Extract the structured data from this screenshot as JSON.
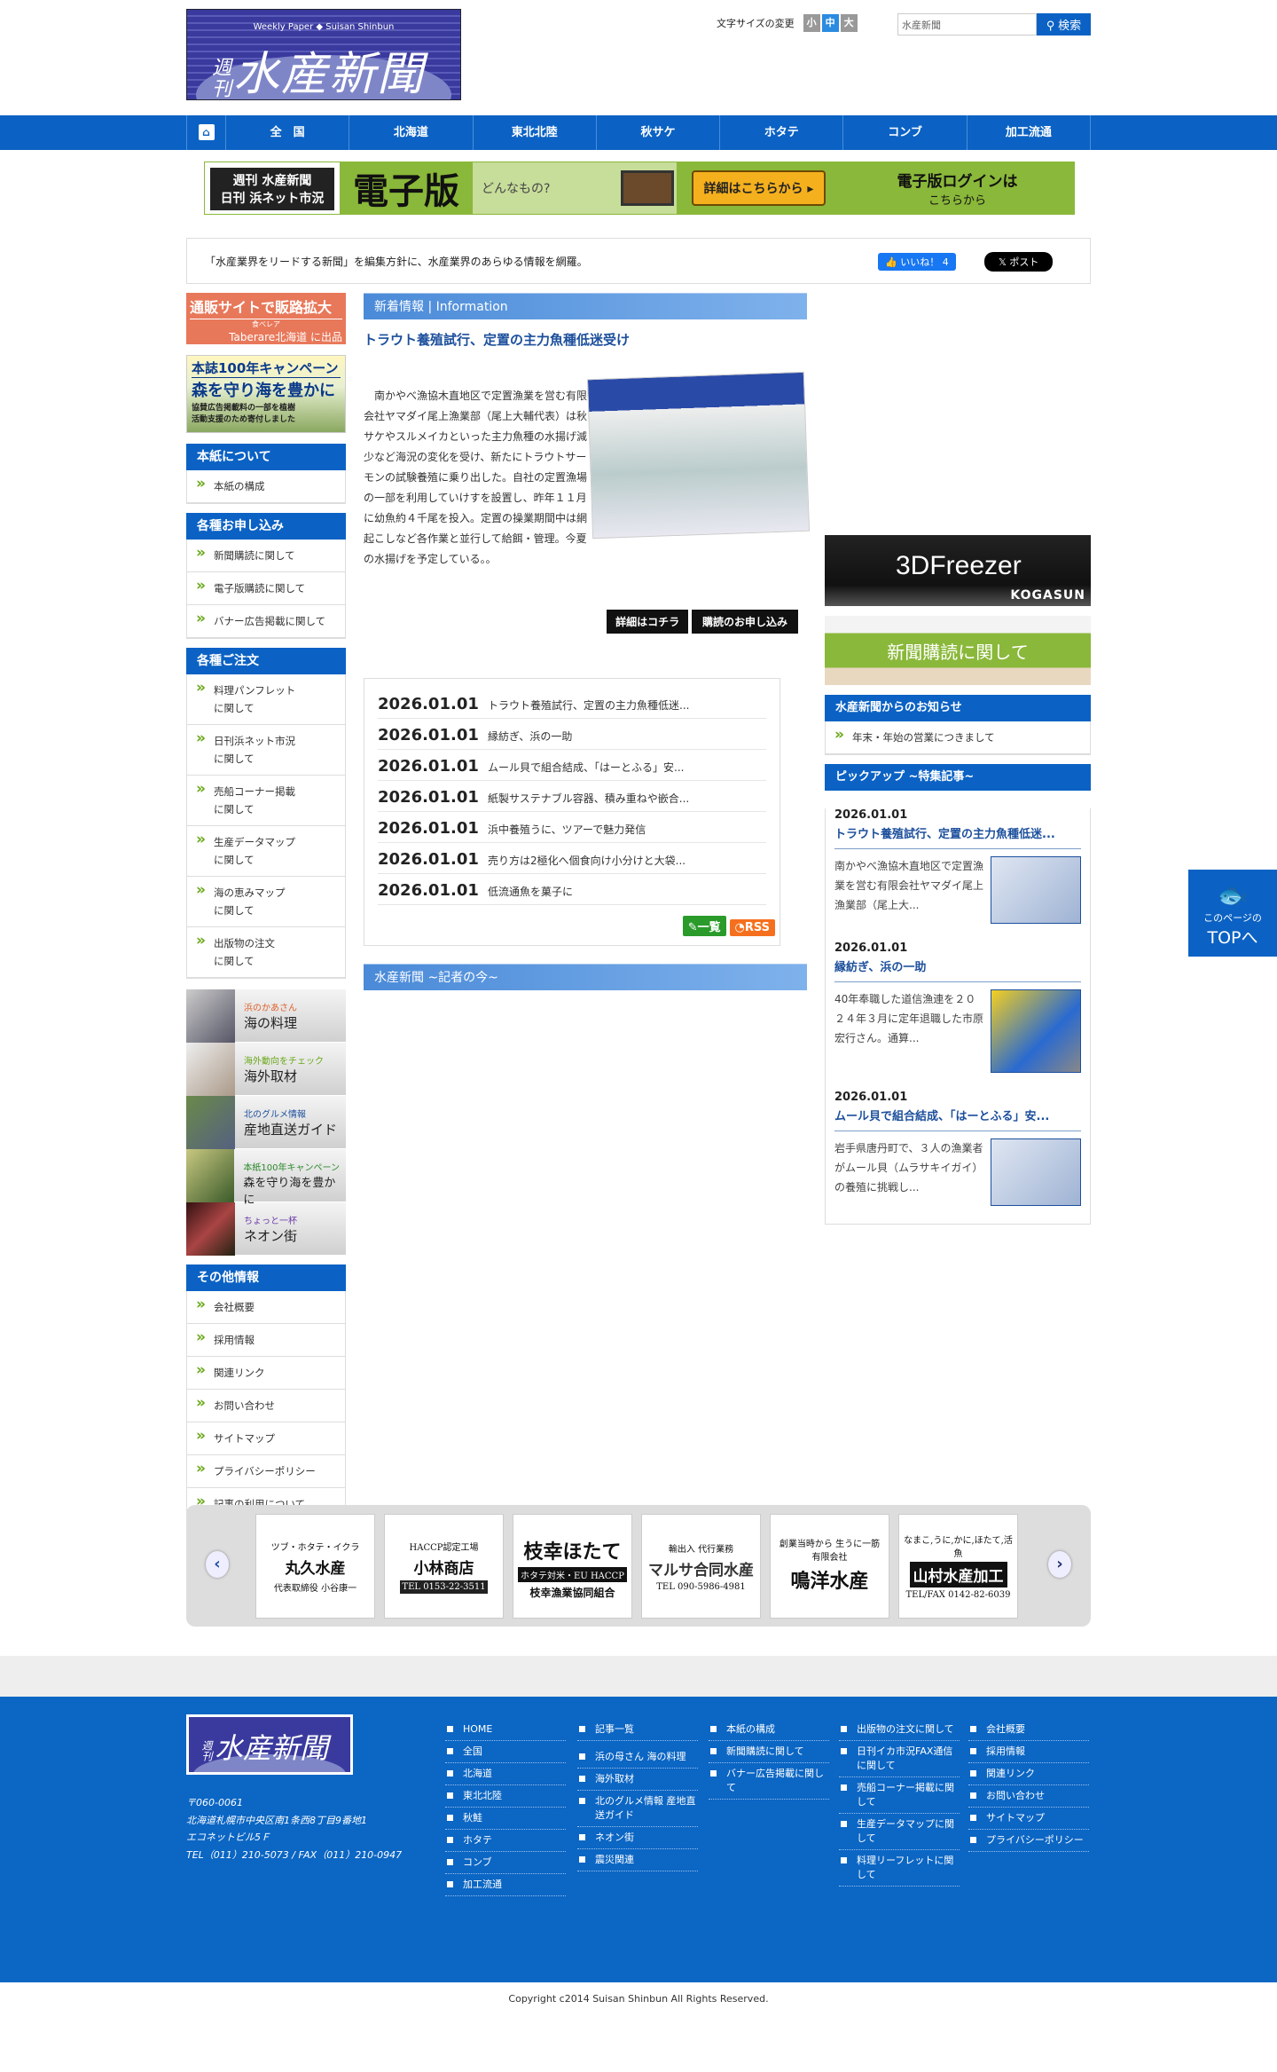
{
  "header": {
    "logo_en": "Weekly Paper ◆ Suisan Shinbun",
    "logo_small": "週刊",
    "logo_jp": "水産新聞",
    "font_size_label": "文字サイズの変更",
    "font_sizes": [
      "小",
      "中",
      "大"
    ],
    "search_value": "水産新聞",
    "search_button": "検索"
  },
  "nav": {
    "items": [
      "全　国",
      "北海道",
      "東北北陸",
      "秋サケ",
      "ホタテ",
      "コンブ",
      "加工流通"
    ]
  },
  "ebanner": {
    "brand1": "週刊 水産新聞",
    "brand2": "日刊 浜ネット市況",
    "title": "電子版",
    "what": "どんなもの?",
    "details": "詳細はこちらから ▸",
    "login": "電子版ログインは",
    "login2": "こちらから"
  },
  "tagline": {
    "text": "「水産業界をリードする新聞」を編集方針に、水産業界のあらゆる情報を網羅。",
    "like": "👍 いいね！ 4",
    "post": "𝕏 ポスト"
  },
  "left": {
    "taberare": {
      "title": "通販サイトで販路拡大",
      "sub": "Taberare北海道 に出品",
      "kana": "食べレア"
    },
    "campaign": {
      "t1": "本誌100年キャンペーン",
      "t2": "森を守り海を豊かに",
      "t3": "協賛広告掲載料の一部を植樹活動支援のため寄付しました"
    },
    "about": {
      "title": "本紙について",
      "items": [
        "本紙の構成"
      ]
    },
    "apply": {
      "title": "各種お申し込み",
      "items": [
        "新聞購読に関して",
        "電子版購読に関して",
        "バナー広告掲載に関して"
      ]
    },
    "order": {
      "title": "各種ご注文",
      "items": [
        [
          "料理パンフレット",
          "に関して"
        ],
        [
          "日刊浜ネット市況",
          "に関して"
        ],
        [
          "売船コーナー掲載",
          "に関して"
        ],
        [
          "生産データマップ",
          "に関して"
        ],
        [
          "海の恵みマップ",
          "に関して"
        ],
        [
          "出版物の注文",
          "に関して"
        ]
      ]
    },
    "features": [
      {
        "s": "浜のかあさん",
        "l": "海の料理",
        "c": "#e0602a"
      },
      {
        "s": "海外動向をチェック",
        "l": "海外取材",
        "c": "#6aa81a"
      },
      {
        "s": "北のグルメ情報",
        "l": "産地直送ガイド",
        "c": "#1c4f9c"
      },
      {
        "s": "本紙100年キャンペーン",
        "l": "森を守り海を豊かに",
        "c": "#2c8a2c"
      },
      {
        "s": "ちょっと一杯",
        "l": "ネオン街",
        "c": "#6a3aa8"
      }
    ],
    "other": {
      "title": "その他情報",
      "items": [
        "会社概要",
        "採用情報",
        "関連リンク",
        "お問い合わせ",
        "サイトマップ",
        "プライバシーポリシー",
        "記事の利用について"
      ]
    }
  },
  "main": {
    "info_header": "新着情報 | Information",
    "headline": "トラウト養殖試行、定置の主力魚種低迷受け",
    "body": "　南かやべ漁協木直地区で定置漁業を営む有限会社ヤマダイ尾上漁業部（尾上大輔代表）は秋サケやスルメイカといった主力魚種の水揚げ減少など海況の変化を受け、新たにトラウトサーモンの試験養殖に乗り出した。自社の定置漁場の一部を利用していけすを設置し、昨年１１月に幼魚約４千尾を投入。定置の操業期間中は網起こしなど各作業と並行して給餌・管理。今夏の水揚げを予定している。。",
    "btn_detail": "詳細はコチラ",
    "btn_subscribe": "購読のお申し込み",
    "news": [
      {
        "d": "2026.01.01",
        "t": "トラウト養殖試行、定置の主力魚種低迷..."
      },
      {
        "d": "2026.01.01",
        "t": "縁紡ぎ、浜の一助"
      },
      {
        "d": "2026.01.01",
        "t": "ムール貝で組合結成、「はーとふる」安..."
      },
      {
        "d": "2026.01.01",
        "t": "紙製サステナブル容器、積み重ねや嵌合..."
      },
      {
        "d": "2026.01.01",
        "t": "浜中養殖うに、ツアーで魅力発信"
      },
      {
        "d": "2026.01.01",
        "t": "売り方は2極化へ個食向け小分けと大袋..."
      },
      {
        "d": "2026.01.01",
        "t": "低流通魚を菓子に"
      }
    ],
    "list_btn": "一覧",
    "rss_btn": "RSS",
    "reporter_header": "水産新聞 ~記者の今~"
  },
  "right": {
    "freezer": {
      "title": "3DFreezer",
      "brand": "KOGASUN"
    },
    "subscribe_banner": "新聞購読に関して",
    "notice": {
      "title": "水産新聞からのお知らせ",
      "items": [
        "年末・年始の営業につきまして"
      ]
    },
    "pickup": {
      "title": "ピックアップ ~特集記事~",
      "items": [
        {
          "d": "2026.01.01",
          "t": "トラウト養殖試行、定置の主力魚種低迷...",
          "b": "南かやべ漁協木直地区で定置漁業を営む有限会社ヤマダイ尾上漁業部（尾上大..."
        },
        {
          "d": "2026.01.01",
          "t": "縁紡ぎ、浜の一助",
          "b": "40年奉職した道信漁連を２０２４年３月に定年退職した市原宏行さん。通算..."
        },
        {
          "d": "2026.01.01",
          "t": "ムール貝で組合結成、「はーとふる」安...",
          "b": "岩手県唐丹町で、３人の漁業者がムール貝（ムラサキイガイ）の養殖に挑戦し..."
        }
      ]
    }
  },
  "top_button": {
    "l1": "このページの",
    "l2": "TOPへ"
  },
  "ads": [
    {
      "a": "ツブ・ホタテ・イクラ",
      "b": "丸久水産",
      "c": "代表取締役 小谷康一"
    },
    {
      "a": "HACCP認定工場",
      "b": "小林商店",
      "c": "TEL 0153-22-3511"
    },
    {
      "a": "枝幸ほたて",
      "b": "枝幸漁業協同組合",
      "c": "ホタテ対米・EU HACCP"
    },
    {
      "a": "輸出入 代行業務",
      "b": "マルサ合同水産",
      "c": "TEL 090-5986-4981"
    },
    {
      "a": "創業当時から 生うに一筋",
      "b": "鳴洋水産",
      "c": "有限会社"
    },
    {
      "a": "なまこ,うに,かに,ほたて,活魚",
      "b": "山村水産加工",
      "c": "TEL/FAX 0142-82-6039"
    }
  ],
  "footer": {
    "logo_small": "週刊",
    "logo_jp": "水産新聞",
    "address": [
      "〒060-0061",
      "北海道札幌市中央区南1条西8丁目9番地1",
      "エコネットビル5Ｆ",
      "TEL（011）210-5073 / FAX（011）210-0947"
    ],
    "col1": [
      "HOME",
      "全国",
      "北海道",
      "東北北陸",
      "秋鮭",
      "ホタテ",
      "コンブ",
      "加工流通"
    ],
    "col2": [
      "記事一覧",
      "浜の母さん 海の料理",
      "海外取材",
      "北のグルメ情報 産地直送ガイド",
      "ネオン街",
      "震災関連"
    ],
    "col3": [
      "本紙の構成",
      "新聞購読に関して",
      "バナー広告掲載に関して"
    ],
    "col4": [
      "出版物の注文に関して",
      "日刊イカ市況FAX通信に関して",
      "売船コーナー掲載に関して",
      "生産データマップに関して",
      "料理リーフレットに関して"
    ],
    "col5": [
      "会社概要",
      "採用情報",
      "関連リンク",
      "お問い合わせ",
      "サイトマップ",
      "プライバシーポリシー"
    ],
    "copyright": "Copyright c2014 Suisan Shinbun All Rights Reserved."
  }
}
